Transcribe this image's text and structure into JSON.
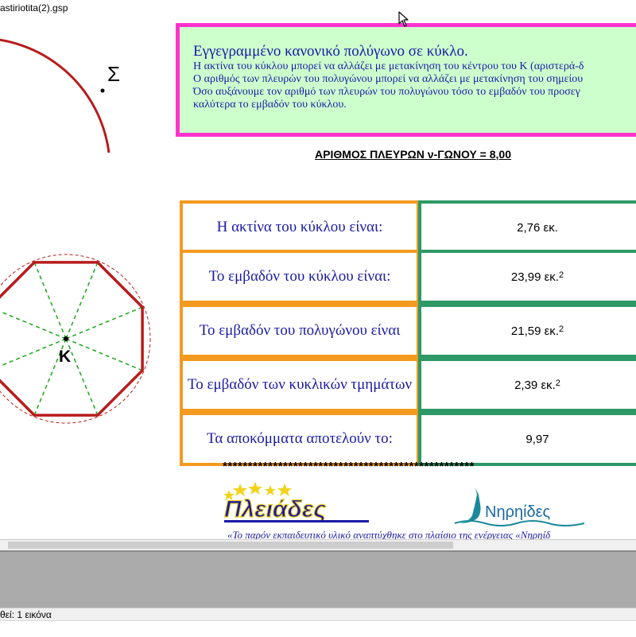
{
  "window": {
    "title": "astiriotita(2).gsp"
  },
  "figure": {
    "point_label_sigma": "Σ",
    "point_label_center": "Κ",
    "polygon_sides": 8
  },
  "info_box": {
    "heading": "Εγγεγραμμένο κανονικό πολύγωνο σε κύκλο.",
    "lines": [
      "Η ακτίνα του κύκλου μπορεί να αλλάζει με μετακίνηση του κέντρου του Κ (αριστερά-δ",
      "Ο αριθμός των πλευρών του πολυγώνου μπορεί να αλλάζει με μετακίνηση του σημείου",
      "Όσο αυξάνουμε τον αριθμό των πλευρών του πολυγώνου τόσο το εμβαδόν του προσεγ",
      "καλύτερα το εμβαδόν του κύκλου."
    ]
  },
  "sides_title": "ΑΡΙΘΜΟΣ ΠΛΕΥΡΩΝ ν-ΓΩΝΟΥ = 8,00",
  "table": {
    "rows": [
      {
        "label": "Η ακτίνα του κύκλου είναι:",
        "value": "2,76 εκ.",
        "sup": ""
      },
      {
        "label": "Το εμβαδόν του κύκλου είναι:",
        "value": "23,99 εκ.",
        "sup": "2"
      },
      {
        "label": "Το εμβαδόν του πολυγώνου είναι",
        "value": "21,59 εκ.",
        "sup": "2"
      },
      {
        "label": "Το εμβαδόν των κυκλικών τμημάτων",
        "value": "2,39 εκ.",
        "sup": "2"
      },
      {
        "label": "Τα αποκόμματα αποτελούν το:",
        "value": "9,97",
        "sup": ""
      }
    ]
  },
  "stars": "**************************************************",
  "logos": {
    "pleiades": "Πλειάδες",
    "nireides": "Νηρηίδες"
  },
  "footer_text": "«Το παρόν εκπαιδευτικό υλικό αναπτύχθηκε στο πλαίσιο της ενέργειας «Νηρηίδ",
  "status": {
    "text": "θεί: 1 εικόνα"
  },
  "colors": {
    "circle": "#b71c1c",
    "polygon": "#b71c1c",
    "spokes": "#1aa61a",
    "info_border": "#ff33cc",
    "info_bg": "#ccffcc",
    "label_border": "#f39a1f",
    "value_border": "#2e9966",
    "text_blue": "#1a1aa6"
  }
}
